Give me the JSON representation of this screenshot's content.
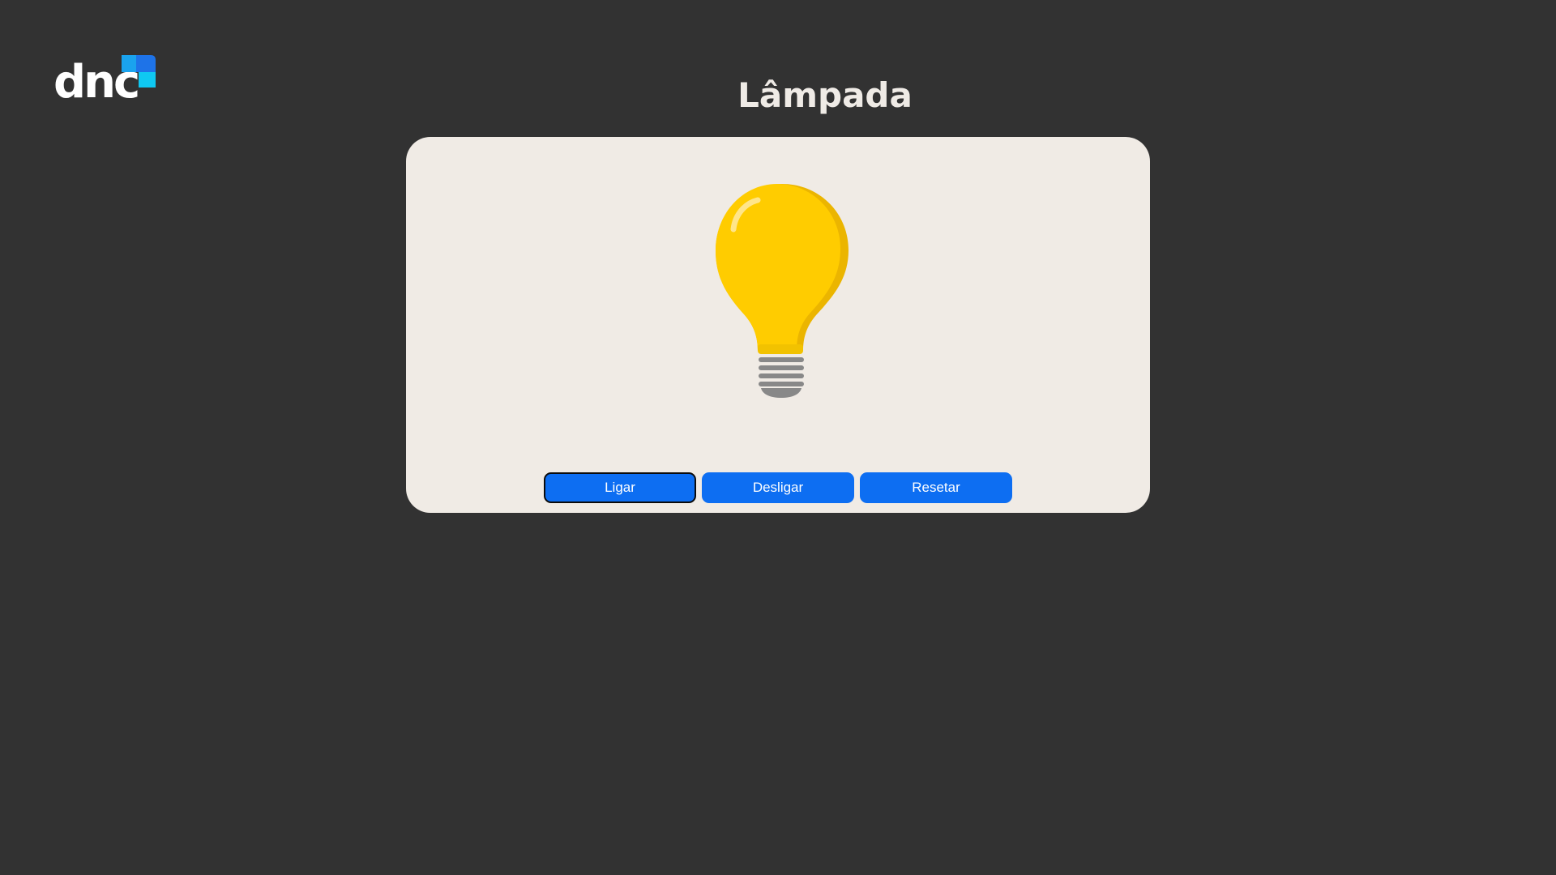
{
  "logo": {
    "text": "dnc",
    "colors": {
      "text": "#ffffff",
      "square_top_left": "#1aa3ee",
      "square_top_right": "#1e73e8",
      "square_bottom_right": "#0fc8f2"
    }
  },
  "page": {
    "title": "Lâmpada"
  },
  "lamp": {
    "icon": "lightbulb-icon",
    "state": "on",
    "colors": {
      "glass": "#ffcc00",
      "glass_shade": "#ebb500",
      "highlight": "#ffe58a",
      "base": "#888888"
    }
  },
  "controls": {
    "on_label": "Ligar",
    "off_label": "Desligar",
    "reset_label": "Resetar",
    "button_color": "#0d6ef2"
  }
}
